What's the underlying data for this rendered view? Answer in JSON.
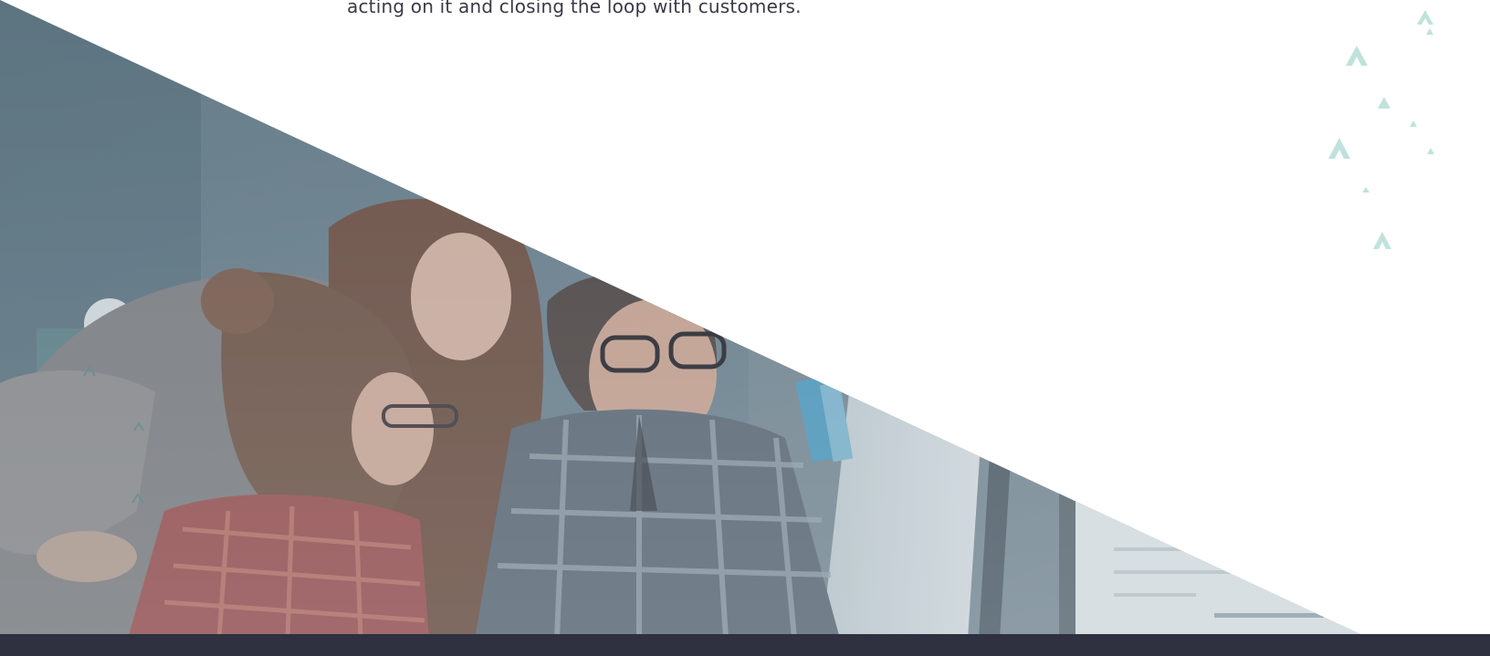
{
  "intro": {
    "text": "acting on it and closing the loop with customers."
  },
  "hero": {
    "icon": "team-photo",
    "overlay_color": "#5d7585"
  },
  "decorations": {
    "icon": "chevron-up-icon",
    "color": "#bfe3dc"
  },
  "footer": {
    "color": "#2f3040"
  }
}
